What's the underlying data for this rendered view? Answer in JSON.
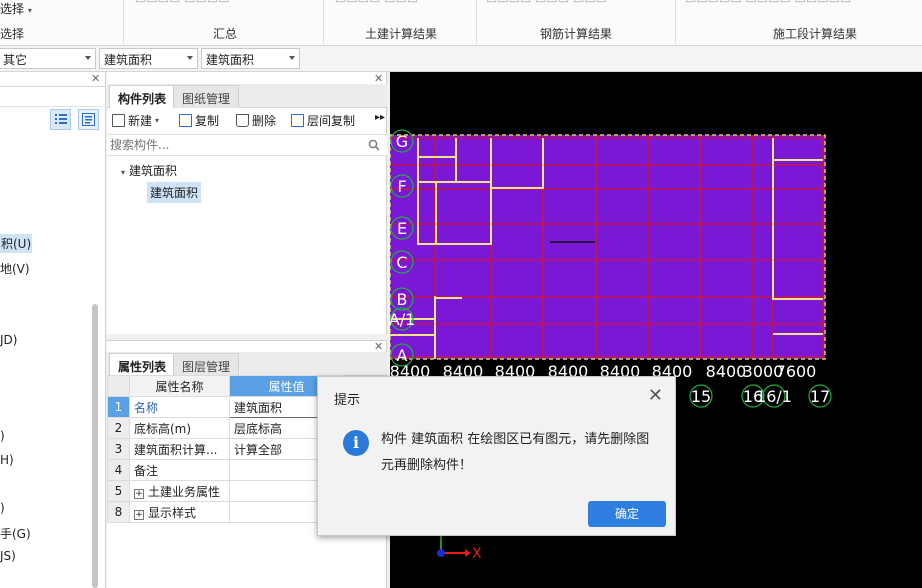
{
  "ribbon": {
    "select_label": "选择",
    "group_summary": "汇总",
    "group_civil": "土建计算结果",
    "group_rebar": "钢筋计算结果",
    "group_construction": "施工段计算结果"
  },
  "selectors": {
    "floor": "其它",
    "type": "建筑面积",
    "component": "建筑面积"
  },
  "nav": {
    "items": [
      "积(U)",
      "地(V)",
      "JD)",
      ")",
      "H)",
      ")",
      "手(G)",
      "JS)"
    ]
  },
  "component_panel": {
    "tab_components": "构件列表",
    "tab_drawings": "图纸管理",
    "tool_new": "新建",
    "tool_copy": "复制",
    "tool_delete": "删除",
    "tool_floor_copy": "层间复制",
    "search_placeholder": "搜索构件...",
    "tree_parent": "建筑面积",
    "tree_child": "建筑面积"
  },
  "property_panel": {
    "tab_props": "属性列表",
    "tab_layers": "图层管理",
    "col_name": "属性名称",
    "col_value": "属性值",
    "rows": [
      {
        "num": "1",
        "name": "名称",
        "value": "建筑面积"
      },
      {
        "num": "2",
        "name": "底标高(m)",
        "value": "层底标高"
      },
      {
        "num": "3",
        "name": "建筑面积计算...",
        "value": "计算全部"
      },
      {
        "num": "4",
        "name": "备注",
        "value": ""
      },
      {
        "num": "5",
        "name": "土建业务属性",
        "value": ""
      },
      {
        "num": "8",
        "name": "显示样式",
        "value": ""
      }
    ]
  },
  "canvas": {
    "row_axes": [
      "G",
      "F",
      "E",
      "C",
      "B",
      "A/1",
      "A"
    ],
    "dims": [
      "8400",
      "8400",
      "8400",
      "8400",
      "8400",
      "8400",
      "8400",
      "3000",
      "7600"
    ],
    "col_axes": [
      "15",
      "16",
      "16/1",
      "17"
    ],
    "axis_x_label": "X",
    "colors": {
      "slab": "#7a18d6",
      "grid": "#d4142e",
      "wall": "#f0e48a",
      "axis": "#22aa44"
    }
  },
  "dialog": {
    "title": "提示",
    "message": "构件 建筑面积 在绘图区已有图元，请先删除图元再删除构件！",
    "ok_label": "确定"
  }
}
